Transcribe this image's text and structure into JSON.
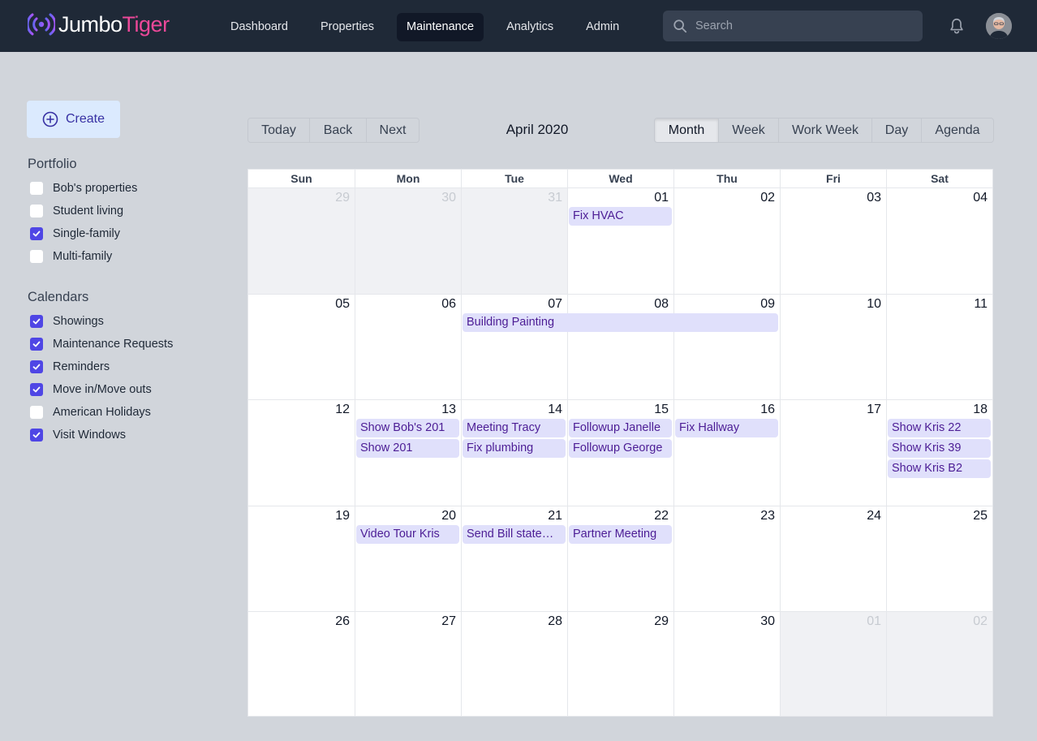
{
  "header": {
    "logo_part1": "Jumbo",
    "logo_part2": "Tiger",
    "nav": [
      {
        "label": "Dashboard",
        "active": false
      },
      {
        "label": "Properties",
        "active": false
      },
      {
        "label": "Maintenance",
        "active": true
      },
      {
        "label": "Analytics",
        "active": false
      },
      {
        "label": "Admin",
        "active": false
      }
    ],
    "search_placeholder": "Search",
    "icons": {
      "search": "search-icon",
      "notifications": "bell-icon",
      "user": "avatar"
    }
  },
  "sidebar": {
    "create_label": "Create",
    "portfolio_title": "Portfolio",
    "portfolio": [
      {
        "label": "Bob's properties",
        "checked": false
      },
      {
        "label": "Student living",
        "checked": false
      },
      {
        "label": "Single-family",
        "checked": true
      },
      {
        "label": "Multi-family",
        "checked": false
      }
    ],
    "calendars_title": "Calendars",
    "calendars": [
      {
        "label": "Showings",
        "checked": true
      },
      {
        "label": "Maintenance Requests",
        "checked": true
      },
      {
        "label": "Reminders",
        "checked": true
      },
      {
        "label": "Move in/Move outs",
        "checked": true
      },
      {
        "label": "American Holidays",
        "checked": false
      },
      {
        "label": "Visit Windows",
        "checked": true
      }
    ]
  },
  "calendar": {
    "nav_buttons": [
      "Today",
      "Back",
      "Next"
    ],
    "title": "April 2020",
    "views": [
      {
        "label": "Month",
        "active": true
      },
      {
        "label": "Week",
        "active": false
      },
      {
        "label": "Work Week",
        "active": false
      },
      {
        "label": "Day",
        "active": false
      },
      {
        "label": "Agenda",
        "active": false
      }
    ],
    "weekdays": [
      "Sun",
      "Mon",
      "Tue",
      "Wed",
      "Thu",
      "Fri",
      "Sat"
    ],
    "weeks": [
      [
        {
          "d": "29",
          "off": true
        },
        {
          "d": "30",
          "off": true
        },
        {
          "d": "31",
          "off": true
        },
        {
          "d": "01"
        },
        {
          "d": "02"
        },
        {
          "d": "03"
        },
        {
          "d": "04"
        }
      ],
      [
        {
          "d": "05"
        },
        {
          "d": "06"
        },
        {
          "d": "07"
        },
        {
          "d": "08"
        },
        {
          "d": "09"
        },
        {
          "d": "10"
        },
        {
          "d": "11"
        }
      ],
      [
        {
          "d": "12"
        },
        {
          "d": "13"
        },
        {
          "d": "14"
        },
        {
          "d": "15"
        },
        {
          "d": "16"
        },
        {
          "d": "17"
        },
        {
          "d": "18"
        }
      ],
      [
        {
          "d": "19"
        },
        {
          "d": "20"
        },
        {
          "d": "21"
        },
        {
          "d": "22"
        },
        {
          "d": "23"
        },
        {
          "d": "24"
        },
        {
          "d": "25"
        }
      ],
      [
        {
          "d": "26"
        },
        {
          "d": "27"
        },
        {
          "d": "28"
        },
        {
          "d": "29"
        },
        {
          "d": "30"
        },
        {
          "d": "01",
          "off": true
        },
        {
          "d": "02",
          "off": true
        }
      ]
    ],
    "events": [
      {
        "title": "Fix HVAC",
        "week": 0,
        "day": 3,
        "span": 1,
        "slot": 0
      },
      {
        "title": "Building Painting",
        "week": 1,
        "day": 2,
        "span": 3,
        "slot": 0
      },
      {
        "title": "Show Bob's 201",
        "week": 2,
        "day": 1,
        "span": 1,
        "slot": 0
      },
      {
        "title": "Show 201",
        "week": 2,
        "day": 1,
        "span": 1,
        "slot": 1
      },
      {
        "title": "Meeting Tracy",
        "week": 2,
        "day": 2,
        "span": 1,
        "slot": 0
      },
      {
        "title": "Fix plumbing",
        "week": 2,
        "day": 2,
        "span": 1,
        "slot": 1
      },
      {
        "title": "Followup Janelle",
        "week": 2,
        "day": 3,
        "span": 1,
        "slot": 0
      },
      {
        "title": "Followup George",
        "week": 2,
        "day": 3,
        "span": 1,
        "slot": 1
      },
      {
        "title": "Fix Hallway",
        "week": 2,
        "day": 4,
        "span": 1,
        "slot": 0
      },
      {
        "title": "Show Kris 22",
        "week": 2,
        "day": 6,
        "span": 1,
        "slot": 0
      },
      {
        "title": "Show Kris 39",
        "week": 2,
        "day": 6,
        "span": 1,
        "slot": 1
      },
      {
        "title": "Show Kris B2",
        "week": 2,
        "day": 6,
        "span": 1,
        "slot": 2
      },
      {
        "title": "Video Tour Kris",
        "week": 3,
        "day": 1,
        "span": 1,
        "slot": 0
      },
      {
        "title": "Send Bill statement",
        "week": 3,
        "day": 2,
        "span": 1,
        "slot": 0
      },
      {
        "title": "Partner Meeting",
        "week": 3,
        "day": 3,
        "span": 1,
        "slot": 0
      }
    ]
  },
  "colors": {
    "header_bg": "#1f2937",
    "accent": "#4f46e5",
    "brand_pink": "#ec4899",
    "event_bg": "#e0e0fb",
    "event_text": "#4c1d95"
  }
}
